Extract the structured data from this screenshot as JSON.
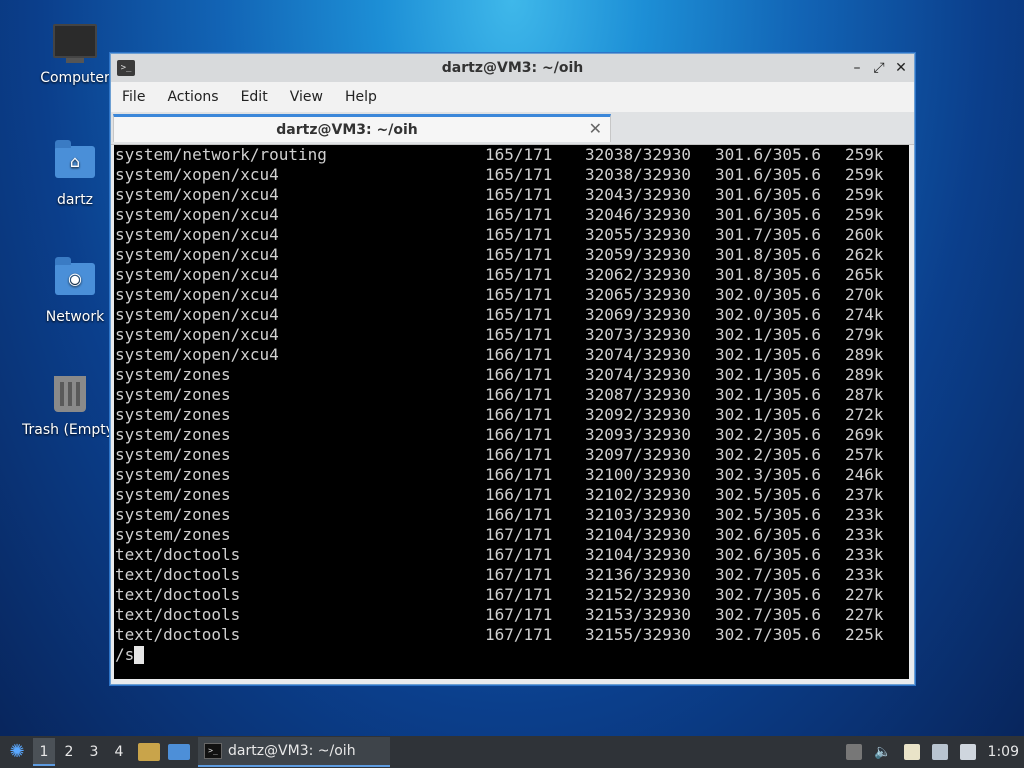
{
  "desktop": {
    "icons": [
      {
        "label": "Computer"
      },
      {
        "label": "dartz"
      },
      {
        "label": "Network"
      },
      {
        "label": "Trash (Empty)"
      }
    ]
  },
  "window": {
    "title": "dartz@VM3: ~/oih",
    "controls": {
      "minimize": "–",
      "maximize": "⤢",
      "close": "✕"
    },
    "menu": [
      "File",
      "Actions",
      "Edit",
      "View",
      "Help"
    ],
    "tab": {
      "label": "dartz@VM3: ~/oih",
      "close": "✕"
    }
  },
  "terminal": {
    "rows": [
      [
        "system/network/routing",
        "165/171",
        "32038/32930",
        "301.6/305.6",
        "259k"
      ],
      [
        "system/xopen/xcu4",
        "165/171",
        "32038/32930",
        "301.6/305.6",
        "259k"
      ],
      [
        "system/xopen/xcu4",
        "165/171",
        "32043/32930",
        "301.6/305.6",
        "259k"
      ],
      [
        "system/xopen/xcu4",
        "165/171",
        "32046/32930",
        "301.6/305.6",
        "259k"
      ],
      [
        "system/xopen/xcu4",
        "165/171",
        "32055/32930",
        "301.7/305.6",
        "260k"
      ],
      [
        "system/xopen/xcu4",
        "165/171",
        "32059/32930",
        "301.8/305.6",
        "262k"
      ],
      [
        "system/xopen/xcu4",
        "165/171",
        "32062/32930",
        "301.8/305.6",
        "265k"
      ],
      [
        "system/xopen/xcu4",
        "165/171",
        "32065/32930",
        "302.0/305.6",
        "270k"
      ],
      [
        "system/xopen/xcu4",
        "165/171",
        "32069/32930",
        "302.0/305.6",
        "274k"
      ],
      [
        "system/xopen/xcu4",
        "165/171",
        "32073/32930",
        "302.1/305.6",
        "279k"
      ],
      [
        "system/xopen/xcu4",
        "166/171",
        "32074/32930",
        "302.1/305.6",
        "289k"
      ],
      [
        "system/zones",
        "166/171",
        "32074/32930",
        "302.1/305.6",
        "289k"
      ],
      [
        "system/zones",
        "166/171",
        "32087/32930",
        "302.1/305.6",
        "287k"
      ],
      [
        "system/zones",
        "166/171",
        "32092/32930",
        "302.1/305.6",
        "272k"
      ],
      [
        "system/zones",
        "166/171",
        "32093/32930",
        "302.2/305.6",
        "269k"
      ],
      [
        "system/zones",
        "166/171",
        "32097/32930",
        "302.2/305.6",
        "257k"
      ],
      [
        "system/zones",
        "166/171",
        "32100/32930",
        "302.3/305.6",
        "246k"
      ],
      [
        "system/zones",
        "166/171",
        "32102/32930",
        "302.5/305.6",
        "237k"
      ],
      [
        "system/zones",
        "166/171",
        "32103/32930",
        "302.5/305.6",
        "233k"
      ],
      [
        "system/zones",
        "167/171",
        "32104/32930",
        "302.6/305.6",
        "233k"
      ],
      [
        "text/doctools",
        "167/171",
        "32104/32930",
        "302.6/305.6",
        "233k"
      ],
      [
        "text/doctools",
        "167/171",
        "32136/32930",
        "302.7/305.6",
        "233k"
      ],
      [
        "text/doctools",
        "167/171",
        "32152/32930",
        "302.7/305.6",
        "227k"
      ],
      [
        "text/doctools",
        "167/171",
        "32153/32930",
        "302.7/305.6",
        "227k"
      ],
      [
        "text/doctools",
        "167/171",
        "32155/32930",
        "302.7/305.6",
        "225k"
      ]
    ],
    "prompt": "/s"
  },
  "taskbar": {
    "workspaces": [
      "1",
      "2",
      "3",
      "4"
    ],
    "active_workspace": "1",
    "task_label": "dartz@VM3: ~/oih",
    "clock": "1:09"
  },
  "colors": {
    "accent": "#3b87d9",
    "terminal_bg": "#000000",
    "terminal_fg": "#d0d0d0",
    "taskbar_bg": "#2f3338"
  }
}
